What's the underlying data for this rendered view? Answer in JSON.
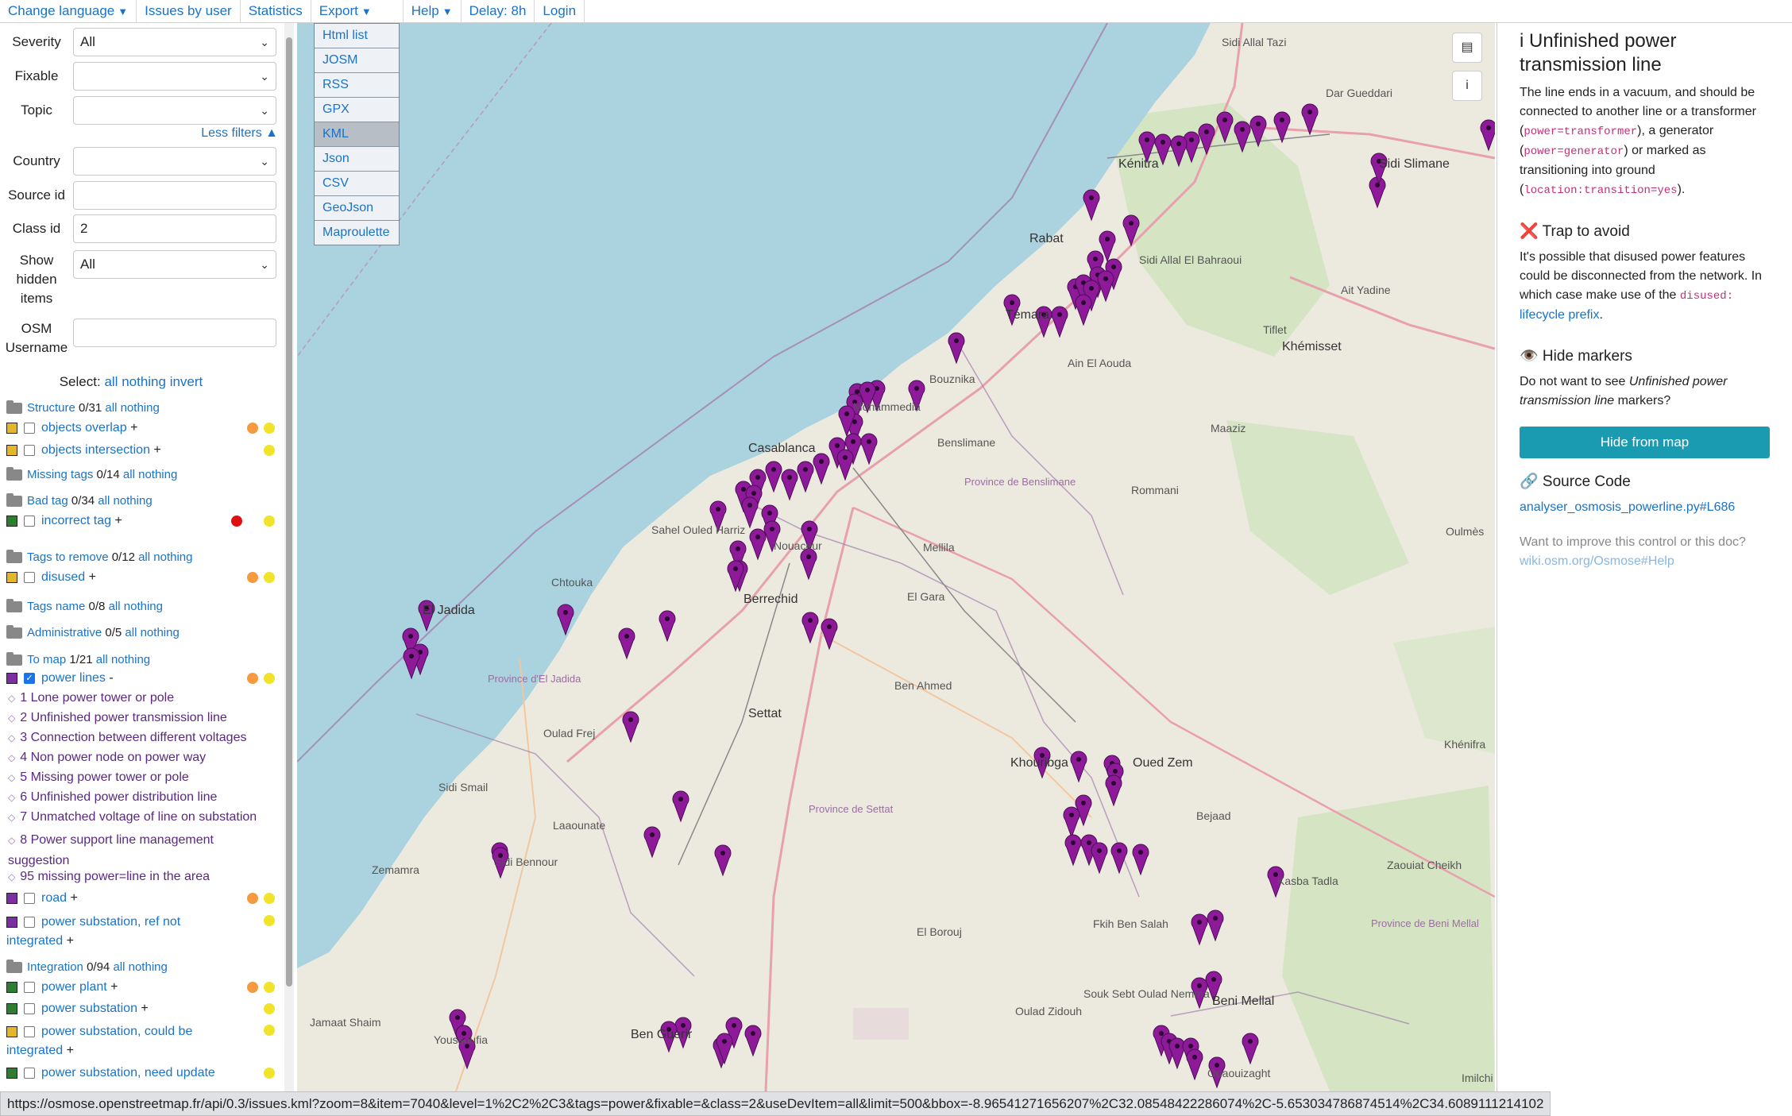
{
  "topbar": {
    "items": [
      {
        "label": "Change language",
        "caret": true
      },
      {
        "label": "Issues by user",
        "caret": false
      },
      {
        "label": "Statistics",
        "caret": false
      },
      {
        "label": "Export",
        "caret": true
      },
      {
        "label": "Help",
        "caret": true
      },
      {
        "label": "Delay: 8h",
        "caret": false
      },
      {
        "label": "Login",
        "caret": false
      }
    ]
  },
  "filters": {
    "severity": {
      "label": "Severity",
      "value": "All"
    },
    "fixable": {
      "label": "Fixable",
      "value": ""
    },
    "topic": {
      "label": "Topic",
      "value": ""
    },
    "less_filters": "Less filters ▲",
    "country": {
      "label": "Country",
      "value": ""
    },
    "source_id": {
      "label": "Source id",
      "value": ""
    },
    "class_id": {
      "label": "Class id",
      "value": "2"
    },
    "show_hidden": {
      "label": "Show hidden items",
      "value": "All"
    },
    "osm_username": {
      "label": "OSM Username",
      "value": ""
    }
  },
  "select": {
    "label": "Select:",
    "all": "all",
    "nothing": "nothing",
    "invert": "invert"
  },
  "categories": {
    "structure": {
      "name": "Structure",
      "count": "0/31"
    },
    "missing_tags": {
      "name": "Missing tags",
      "count": "0/14"
    },
    "bad_tag": {
      "name": "Bad tag",
      "count": "0/34"
    },
    "tags_to_remove": {
      "name": "Tags to remove",
      "count": "0/12"
    },
    "tags_name": {
      "name": "Tags name",
      "count": "0/8"
    },
    "administrative": {
      "name": "Administrative",
      "count": "0/5"
    },
    "to_map": {
      "name": "To map",
      "count": "1/21"
    },
    "integration": {
      "name": "Integration",
      "count": "0/94"
    },
    "all": "all",
    "nothing": "nothing"
  },
  "items": {
    "objects_overlap": "objects overlap",
    "objects_intersection": "objects intersection",
    "incorrect_tag": "incorrect tag",
    "disused": "disused",
    "power_lines": "power lines",
    "road": "road",
    "power_substation_ref": "power substation, ref not integrated",
    "power_plant": "power plant",
    "power_substation": "power substation",
    "power_substation_could": "power substation, could be integrated",
    "power_substation_update": "power substation, need update",
    "plus": "+",
    "minus": "-"
  },
  "power_classes": [
    "1 Lone power tower or pole",
    "2 Unfinished power transmission line",
    "3 Connection between different voltages",
    "4 Non power node on power way",
    "5 Missing power tower or pole",
    "6 Unfinished power distribution line",
    "7 Unmatched voltage of line on substation",
    "8 Power support line management suggestion",
    "95 missing power=line in the area"
  ],
  "export_menu": [
    "Html list",
    "JOSM",
    "RSS",
    "GPX",
    "KML",
    "Json",
    "CSV",
    "GeoJson",
    "Maproulette"
  ],
  "map_labels": [
    "Sidi Allal Tazi",
    "Dar Gueddari",
    "Kénitra",
    "Sidi Slimane",
    "Rabat",
    "Témara",
    "Sidi Allal El Bahraoui",
    "Ait Yadine",
    "Ain El Aouda",
    "Tiflet",
    "Khémisset",
    "Bouznika",
    "Casablanca",
    "Benslimane",
    "Province de Benslimane",
    "Maaziz",
    "Rommani",
    "Mohammedia",
    "Sahel Ouled Harriz",
    "Nouaceur",
    "Mellila",
    "El Jadida",
    "Chtouka",
    "Berrechid",
    "El Gara",
    "Oulmès",
    "Ben Ahmed",
    "Province d'El Jadida",
    "Settat",
    "Oulad Frej",
    "Khouribga",
    "Oued Zem",
    "Khénifra",
    "Sidi Smail",
    "Laaounate",
    "Province de Settat",
    "Bejaad",
    "Zemamra",
    "Sidi Bennour",
    "Kasba Tadla",
    "Zaouiat Cheikh",
    "El Borouj",
    "Fkih Ben Salah",
    "Province de Beni Mellal",
    "Jamaat Shaim",
    "Oulad Zidouh",
    "Souk Sebt Oulad Nemma",
    "Beni Mellal",
    "Youssoufia",
    "Ben Guerir",
    "Ouaouizaght",
    "Imilchi"
  ],
  "right_panel": {
    "title": "i Unfinished power transmission line",
    "desc_1": "The line ends in a vacuum, and should be connected to another line or a transformer (",
    "code_1": "power=transformer",
    "desc_2": "), a generator (",
    "code_2": "power=generator",
    "desc_3": ") or marked as transitioning into ground (",
    "code_3": "location:transition=yes",
    "desc_4": ").",
    "trap_title": "❌ Trap to avoid",
    "trap_1": "It's possible that disused power features could be disconnected from the network. In which case make use of the ",
    "trap_code": "disused:",
    "trap_link": "lifecycle prefix",
    "trap_end": ".",
    "hide_title": "👁️ Hide markers",
    "hide_1": "Do not want to see ",
    "hide_em": "Unfinished power transmission line",
    "hide_2": " markers?",
    "hide_button": "Hide from map",
    "source_title": "🔗 Source Code",
    "source_link": "analyser_osmosis_powerline.py#L686",
    "improve": "Want to improve this control or this doc?",
    "improve_link": "wiki.osm.org/Osmose#Help"
  },
  "status_url": "https://osmose.openstreetmap.fr/api/0.3/issues.kml?zoom=8&item=7040&level=1%2C2%2C3&tags=power&fixable=&class=2&useDevItem=all&limit=500&bbox=-8.96541271656207%2C32.08548422286074%2C-5.653034786874514%2C34.6089111214102",
  "colors": {
    "link": "#1a73c7",
    "sea": "#aad3df",
    "marker": "#8e1a9a",
    "button": "#1a9bb2",
    "orange": "#f59a3e",
    "yellow": "#f0e32a",
    "red": "#e01010"
  }
}
